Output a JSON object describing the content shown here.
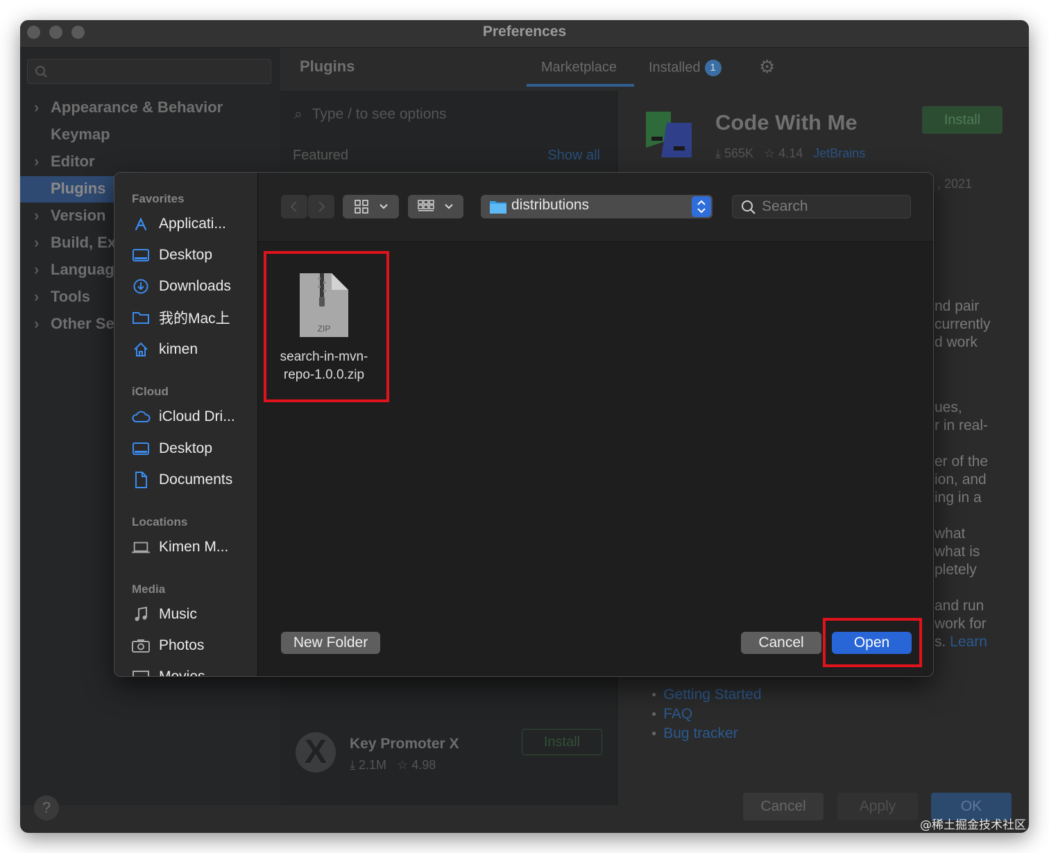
{
  "window": {
    "title": "Preferences"
  },
  "sidebar": {
    "items": [
      {
        "label": "Appearance & Behavior",
        "expandable": true
      },
      {
        "label": "Keymap",
        "expandable": false
      },
      {
        "label": "Editor",
        "expandable": true
      },
      {
        "label": "Plugins",
        "expandable": false,
        "selected": true
      },
      {
        "label": "Version",
        "expandable": true
      },
      {
        "label": "Build, Ex",
        "expandable": true
      },
      {
        "label": "Languag",
        "expandable": true
      },
      {
        "label": "Tools",
        "expandable": true
      },
      {
        "label": "Other Se",
        "expandable": true
      }
    ]
  },
  "plugins": {
    "title": "Plugins",
    "tabs": {
      "marketplace": "Marketplace",
      "installed": "Installed",
      "installed_badge": "1"
    },
    "search_placeholder": "Type / to see options",
    "featured_label": "Featured",
    "show_all": "Show all",
    "list_item": {
      "name": "Key Promoter X",
      "downloads": "2.1M",
      "rating": "4.98",
      "install": "Install"
    }
  },
  "detail": {
    "name": "Code With Me",
    "downloads": "565K",
    "rating": "4.14",
    "vendor": "JetBrains",
    "install": "Install",
    "date": ", 2021",
    "desc_lines": [
      "nd pair",
      "currently",
      "d work",
      "",
      "ues,",
      "r in real-",
      "",
      "er of the",
      "ion, and",
      "ing in a",
      "",
      "what",
      "what is",
      "pletely",
      "",
      "and run",
      "work for"
    ],
    "desc_last_prefix": "s. ",
    "desc_last_link": "Learn",
    "links": [
      "Getting Started",
      "FAQ",
      "Bug tracker"
    ]
  },
  "pref_buttons": {
    "cancel": "Cancel",
    "apply": "Apply",
    "ok": "OK",
    "help": "?"
  },
  "dialog": {
    "sections": {
      "favorites": "Favorites",
      "icloud": "iCloud",
      "locations": "Locations",
      "media": "Media"
    },
    "favorites": [
      "Applicati...",
      "Desktop",
      "Downloads",
      "我的Mac上",
      "kimen"
    ],
    "icloud": [
      "iCloud Dri...",
      "Desktop",
      "Documents"
    ],
    "locations": [
      "Kimen M..."
    ],
    "media": [
      "Music",
      "Photos",
      "Movies"
    ],
    "path": "distributions",
    "search_placeholder": "Search",
    "file": {
      "type_label": "ZIP",
      "name_line1": "search-in-mvn-",
      "name_line2": "repo-1.0.0.zip"
    },
    "buttons": {
      "new_folder": "New Folder",
      "cancel": "Cancel",
      "open": "Open"
    }
  },
  "watermark": "@稀土掘金技术社区",
  "colors": {
    "accent_blue": "#2866d8",
    "highlight_red": "#e0131c",
    "install_green": "#2d4d33"
  }
}
